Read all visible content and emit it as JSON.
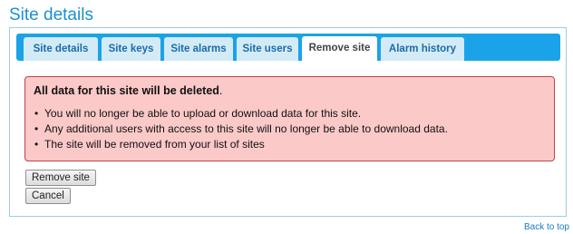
{
  "page": {
    "title": "Site details"
  },
  "tabs": [
    {
      "label": "Site details",
      "active": false
    },
    {
      "label": "Site keys",
      "active": false
    },
    {
      "label": "Site alarms",
      "active": false
    },
    {
      "label": "Site users",
      "active": false
    },
    {
      "label": "Remove site",
      "active": true
    },
    {
      "label": "Alarm history",
      "active": false
    }
  ],
  "alert": {
    "heading_bold": "All data for this site will be deleted",
    "heading_suffix": ".",
    "items": [
      "You will no longer be able to upload or download data for this site.",
      "Any additional users with access to this site will no longer be able to download data.",
      "The site will be removed from your list of sites"
    ]
  },
  "actions": {
    "remove_label": "Remove site",
    "cancel_label": "Cancel"
  },
  "footer": {
    "back_to_top": "Back to top"
  },
  "colors": {
    "title": "#1b8fd0",
    "tabbar": "#1aa3e8",
    "tab_inactive": "#d3ebf7",
    "alert_bg": "#fcc9c9",
    "alert_border": "#c0444a",
    "link": "#1b7cc0"
  }
}
